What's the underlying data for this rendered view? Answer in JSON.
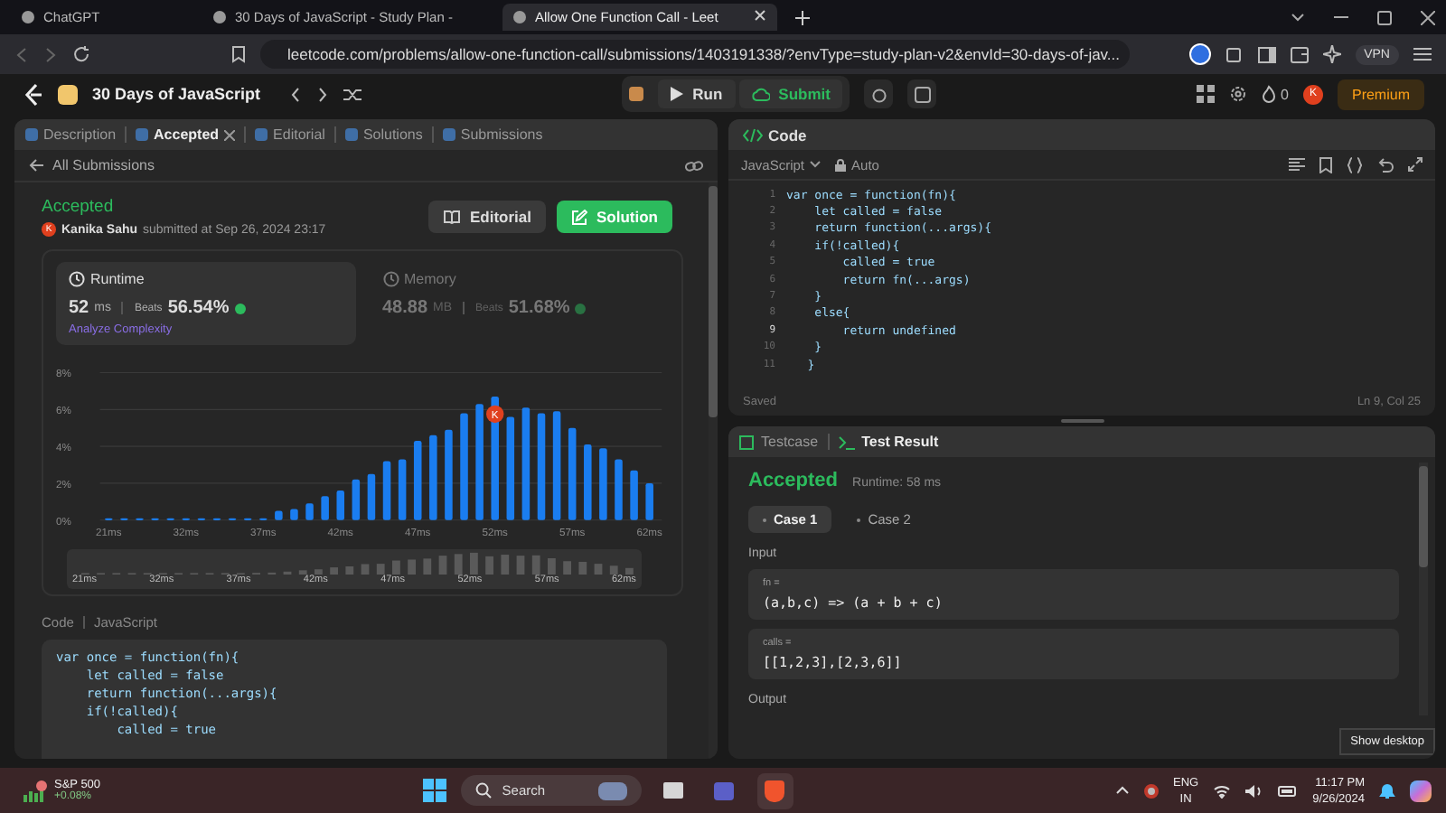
{
  "browser": {
    "tabs": [
      {
        "title": "ChatGPT",
        "selected": false
      },
      {
        "title": "30 Days of JavaScript - Study Plan -",
        "selected": false
      },
      {
        "title": "Allow One Function Call - Leet",
        "selected": true
      }
    ],
    "url": "leetcode.com/problems/allow-one-function-call/submissions/1403191338/?envType=study-plan-v2&envId=30-days-of-jav...",
    "vpn": "VPN"
  },
  "nav": {
    "study_plan": "30 Days of JavaScript",
    "run": "Run",
    "submit": "Submit",
    "streak": "0",
    "avatar": "K",
    "premium": "Premium"
  },
  "left": {
    "tabs": [
      {
        "label": "Description",
        "selected": false,
        "closable": false
      },
      {
        "label": "Accepted",
        "selected": true,
        "closable": true
      },
      {
        "label": "Editorial",
        "selected": false,
        "closable": false
      },
      {
        "label": "Solutions",
        "selected": false,
        "closable": false
      },
      {
        "label": "Submissions",
        "selected": false,
        "closable": false
      }
    ],
    "back": "All Submissions",
    "status": "Accepted",
    "avatar": "K",
    "author": "Kanika Sahu",
    "submitted": "submitted at Sep 26, 2024 23:17",
    "editorial": "Editorial",
    "solution": "Solution",
    "metrics": [
      {
        "title": "Runtime",
        "value": "52",
        "unit": "ms",
        "beats_label": "Beats",
        "beats": "56.54%",
        "selected": true,
        "link": "Analyze Complexity"
      },
      {
        "title": "Memory",
        "value": "48.88",
        "unit": "MB",
        "beats_label": "Beats",
        "beats": "51.68%",
        "selected": false
      }
    ],
    "chart_data": {
      "type": "bar",
      "grid": true,
      "categories": [
        "21ms",
        null,
        null,
        null,
        null,
        "32ms",
        null,
        null,
        null,
        null,
        "37ms",
        null,
        null,
        null,
        null,
        "42ms",
        null,
        null,
        null,
        null,
        "47ms",
        null,
        null,
        null,
        null,
        "52ms",
        null,
        null,
        null,
        null,
        "57ms",
        null,
        null,
        null,
        null,
        "62ms"
      ],
      "values": [
        0.1,
        0.1,
        0.1,
        0.1,
        0.1,
        0.1,
        0.1,
        0.1,
        0.1,
        0.1,
        0.1,
        0.5,
        0.6,
        0.9,
        1.3,
        1.6,
        2.2,
        2.5,
        3.2,
        3.3,
        4.3,
        4.6,
        4.9,
        5.8,
        6.3,
        6.7,
        5.6,
        6.1,
        5.8,
        5.9,
        5.0,
        4.1,
        3.9,
        3.3,
        2.7,
        2.0
      ],
      "ylim": [
        0,
        8
      ],
      "yticks": [
        {
          "value": 8,
          "label": "8%"
        },
        {
          "value": 6,
          "label": "6%"
        },
        {
          "value": 4,
          "label": "4%"
        },
        {
          "value": 2,
          "label": "2%"
        },
        {
          "value": 0,
          "label": "0%"
        }
      ],
      "annotations": [
        {
          "x": "52ms",
          "text": "K"
        }
      ]
    },
    "overview": {
      "labels": [
        "21ms",
        "32ms",
        "37ms",
        "42ms",
        "47ms",
        "52ms",
        "57ms",
        "62ms"
      ]
    },
    "code_label": "Code",
    "code_lang": "JavaScript",
    "code": [
      "var once = function(fn){",
      "    let called = false",
      "    return function(...args){",
      "    if(!called){",
      "        called = true"
    ]
  },
  "editor": {
    "title": "Code",
    "language": "JavaScript",
    "mode": "Auto",
    "lines": [
      {
        "no": "1",
        "text": "var once = function(fn){",
        "current": false
      },
      {
        "no": "2",
        "text": "    let called = false",
        "current": false
      },
      {
        "no": "3",
        "text": "    return function(...args){",
        "current": false
      },
      {
        "no": "4",
        "text": "    if(!called){",
        "current": false
      },
      {
        "no": "5",
        "text": "        called = true",
        "current": false
      },
      {
        "no": "6",
        "text": "        return fn(...args)",
        "current": false
      },
      {
        "no": "7",
        "text": "    }",
        "current": false
      },
      {
        "no": "8",
        "text": "    else{",
        "current": false
      },
      {
        "no": "9",
        "text": "        return undefined",
        "current": true
      },
      {
        "no": "10",
        "text": "    }",
        "current": false
      },
      {
        "no": "11",
        "text": "   }",
        "current": false
      }
    ],
    "saved": "Saved",
    "cursor": "Ln 9, Col 25"
  },
  "console": {
    "tabs": [
      {
        "label": "Testcase",
        "selected": false
      },
      {
        "label": "Test Result",
        "selected": true
      }
    ],
    "status": "Accepted",
    "runtime": "Runtime: 58 ms",
    "cases": [
      {
        "label": "Case 1",
        "selected": true
      },
      {
        "label": "Case 2",
        "selected": false
      }
    ],
    "input_label": "Input",
    "params": [
      {
        "name": "fn =",
        "value": "(a,b,c) => (a + b + c)"
      },
      {
        "name": "calls =",
        "value": "[[1,2,3],[2,3,6]]"
      }
    ],
    "output_label": "Output"
  },
  "tooltip": "Show desktop",
  "taskbar": {
    "stock_name": "S&P 500",
    "stock_change": "+0.08%",
    "search": "Search",
    "lang": "ENG",
    "region": "IN",
    "time": "11:17 PM",
    "date": "9/26/2024"
  }
}
